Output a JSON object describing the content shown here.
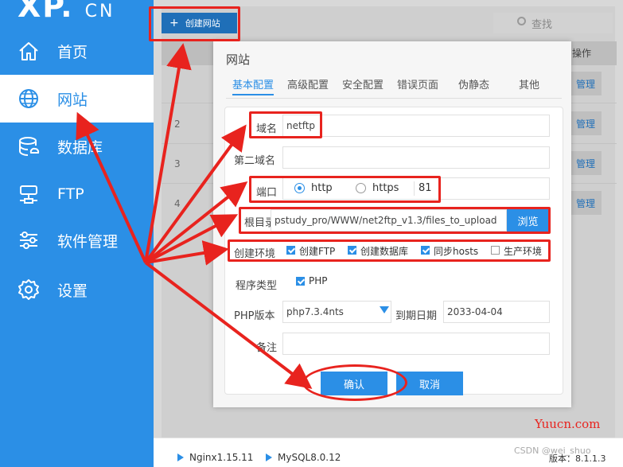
{
  "logo": {
    "main": "XP.",
    "suffix": "CN"
  },
  "sidebar": {
    "items": [
      {
        "label": "首页",
        "icon": "home-icon"
      },
      {
        "label": "网站",
        "icon": "globe-icon",
        "active": true
      },
      {
        "label": "数据库",
        "icon": "database-icon"
      },
      {
        "label": "FTP",
        "icon": "ftp-icon"
      },
      {
        "label": "软件管理",
        "icon": "sliders-icon"
      },
      {
        "label": "设置",
        "icon": "gear-icon"
      }
    ]
  },
  "toolbar": {
    "add_site_label": "创建网站",
    "search_placeholder": "查找"
  },
  "table": {
    "op_header": "操作",
    "row_numbers": [
      "2",
      "3",
      "4"
    ],
    "manage_label": "管理"
  },
  "modal": {
    "title": "网站",
    "tabs": [
      "基本配置",
      "高级配置",
      "安全配置",
      "错误页面",
      "伪静态",
      "其他"
    ],
    "domain_label": "域名",
    "domain_value": "netftp",
    "second_domain_label": "第二域名",
    "second_domain_value": "",
    "port_label": "端口",
    "protocol_options": [
      "http",
      "https"
    ],
    "protocol_selected": "http",
    "port_value": "81",
    "root_label": "根目录",
    "root_value": "pstudy_pro/WWW/net2ftp_v1.3/files_to_upload",
    "browse_label": "浏览",
    "env_label": "创建环境",
    "env_options": [
      {
        "label": "创建FTP",
        "checked": true
      },
      {
        "label": "创建数据库",
        "checked": true
      },
      {
        "label": "同步hosts",
        "checked": true
      },
      {
        "label": "生产环境",
        "checked": false
      }
    ],
    "program_type_label": "程序类型",
    "program_type_option": {
      "label": "PHP",
      "checked": true
    },
    "php_version_label": "PHP版本",
    "php_version_value": "php7.3.4nts",
    "expire_label": "到期日期",
    "expire_value": "2033-04-04",
    "note_label": "备注",
    "note_value": "",
    "confirm_label": "确认",
    "cancel_label": "取消"
  },
  "footer": {
    "nginx": "Nginx1.15.11",
    "mysql": "MySQL8.0.12",
    "version": "版本：8.1.1.3",
    "watermark": "Yuucn.com",
    "csdn": "CSDN @wei_shuo"
  },
  "colors": {
    "accent": "#2b8fe6",
    "annotation": "#e8231e",
    "sidebar_bg": "#2b8fe6"
  }
}
